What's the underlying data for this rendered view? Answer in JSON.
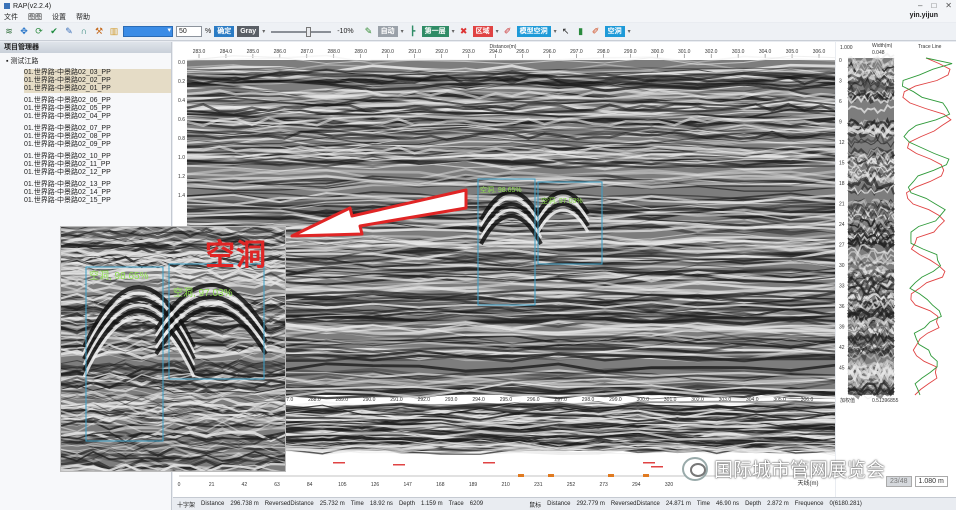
{
  "window": {
    "title": "RAP(v2.2.4)",
    "user": "yin.yijun"
  },
  "menu": [
    "文件",
    "图图",
    "设置",
    "帮助"
  ],
  "toolbar": {
    "opacity_value": "50",
    "percent": "%",
    "confirm": "确定",
    "colormap": "Gray",
    "gain_label": "-10%",
    "btn_auto": "自动",
    "btn_layer": "第一层",
    "btn_area": "区域",
    "btn_model": "模型空洞",
    "btn_void": "空洞"
  },
  "sidebar": {
    "title": "项目管理器",
    "root": "测试江路",
    "groups": [
      [
        "01.世界路-中景路02_03_PP",
        "01.世界路-中景路02_02_PP",
        "01.世界路-中景路02_01_PP"
      ],
      [
        "01.世界路-中景路02_06_PP",
        "01.世界路-中景路02_05_PP",
        "01.世界路-中景路02_04_PP"
      ],
      [
        "01.世界路-中景路02_07_PP",
        "01.世界路-中景路02_08_PP",
        "01.世界路-中景路02_09_PP"
      ],
      [
        "01.世界路-中景路02_10_PP",
        "01.世界路-中景路02_11_PP",
        "01.世界路-中景路02_12_PP"
      ],
      [
        "01.世界路-中景路02_13_PP",
        "01.世界路-中景路02_14_PP",
        "01.世界路-中景路02_15_PP"
      ]
    ],
    "selected_group": 0
  },
  "radargram": {
    "distance_title": "Distance(m)",
    "top_ticks": [
      "283.0",
      "284.0",
      "285.0",
      "286.0",
      "287.0",
      "288.0",
      "289.0",
      "290.0",
      "291.0",
      "292.0",
      "293.0",
      "294.0",
      "295.0",
      "296.0",
      "297.0",
      "298.0",
      "299.0",
      "300.0",
      "301.0",
      "302.0",
      "303.0",
      "304.0",
      "305.0",
      "306.0"
    ],
    "bottom_ticks": [
      "287.0",
      "288.0",
      "289.0",
      "290.0",
      "291.0",
      "292.0",
      "293.0",
      "294.0",
      "295.0",
      "296.0",
      "297.0",
      "298.0",
      "299.0",
      "300.0",
      "301.0",
      "302.0",
      "303.0",
      "304.0",
      "305.0",
      "306.0"
    ],
    "left_ticks": [
      "0.0",
      "0.2",
      "0.4",
      "0.6",
      "0.8",
      "1.0",
      "1.2",
      "1.4"
    ],
    "right_ticks": [
      "0",
      "3",
      "6",
      "9",
      "12",
      "15",
      "18",
      "21",
      "24",
      "27",
      "30",
      "33",
      "36",
      "39",
      "42",
      "45"
    ],
    "detections": [
      {
        "label": "空洞, 98.65%"
      },
      {
        "label": "空洞, 97.03%"
      }
    ],
    "callout": "空洞"
  },
  "minimap": {
    "ticks": [
      "0",
      "21",
      "42",
      "63",
      "84",
      "105",
      "126",
      "147",
      "168",
      "189",
      "210",
      "231",
      "252",
      "273",
      "294",
      "320"
    ],
    "unit_label": "天线(m)"
  },
  "side_panels": {
    "width_label": "Width(m)",
    "width_value": "0.048",
    "start_label": "1.000",
    "trace_label": "Trace Line",
    "bottom_label": "加权值",
    "bottom_value": "0.51396855"
  },
  "status": {
    "left": {
      "name": "十字架",
      "distance_label": "Distance",
      "distance": "296.738 m",
      "rdist_label": "ReversedDistance",
      "rdist": "25.732 m",
      "time_label": "Time",
      "time": "18.92 ns",
      "depth_label": "Depth",
      "depth": "1.159 m",
      "trace_label": "Trace",
      "trace": "6209"
    },
    "right": {
      "name": "鼠标",
      "distance_label": "Distance",
      "distance": "292.779 m",
      "rdist_label": "ReversedDistance",
      "rdist": "24.871 m",
      "time_label": "Time",
      "time": "46.90 ns",
      "depth_label": "Depth",
      "depth": "2.872 m",
      "freq_label": "Frequence",
      "freq": "0(6180.281)"
    }
  },
  "pager": {
    "page": "23/48",
    "zoom": "1.080 m"
  },
  "watermark": "国际城市管网展览会",
  "colors": {
    "accent": "#3b8ce6",
    "detection_label": "#8fe04f",
    "detection_box": "#3aa0c8",
    "callout": "#e02525"
  }
}
